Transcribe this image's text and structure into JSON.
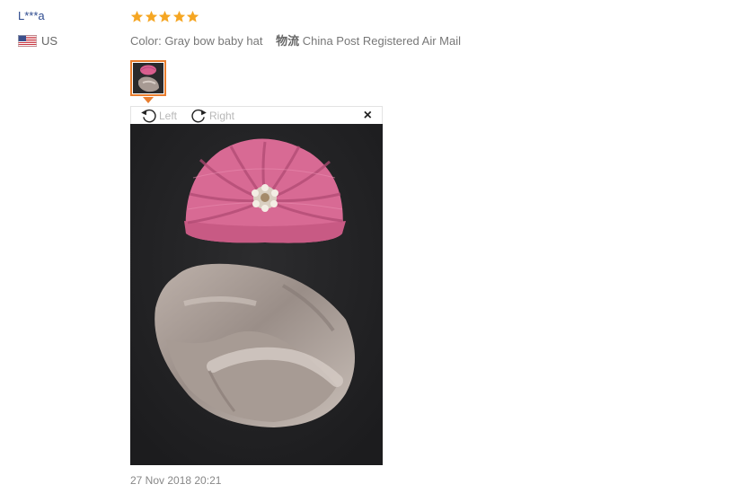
{
  "review": {
    "reviewer_name": "L***a",
    "country_code": "US",
    "rating": 5,
    "sku_label": "Color:",
    "sku_value": "Gray bow baby hat",
    "logistics_label": "物流",
    "logistics_value": "China Post Registered Air Mail",
    "date": "27 Nov 2018 20:21"
  },
  "viewer": {
    "rotate_left_label": "Left",
    "rotate_right_label": "Right",
    "close_label": "×"
  },
  "icons": [
    "us-flag-icon",
    "star-icon",
    "rotate-left-icon",
    "rotate-right-icon",
    "close-icon"
  ],
  "colors": {
    "star": "#f5a623",
    "thumb_border": "#e87d2e",
    "name_link": "#2e4b8f"
  }
}
